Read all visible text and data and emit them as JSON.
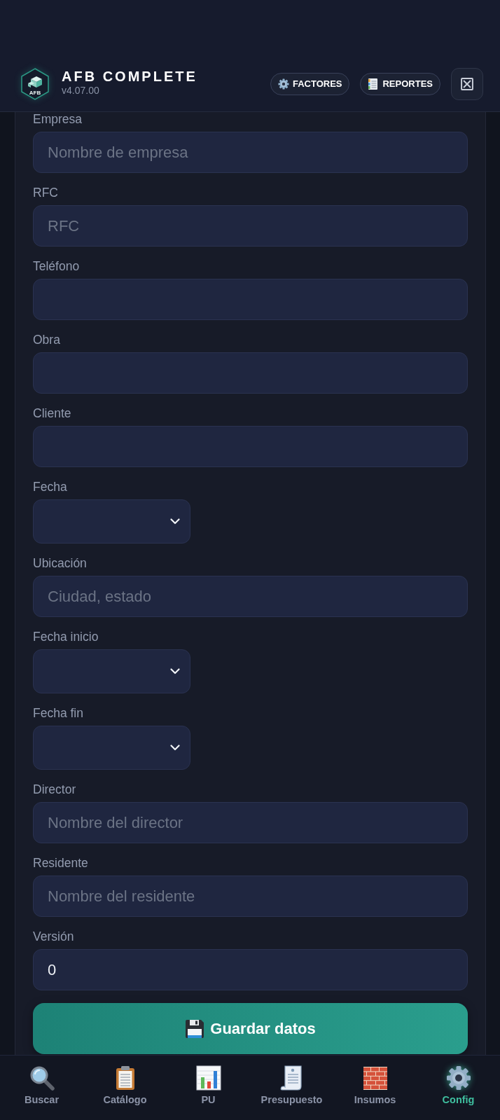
{
  "app": {
    "logo_text": "AFB",
    "title": "AFB COMPLETE",
    "version": "v4.07.00"
  },
  "header_buttons": [
    {
      "label": "FACTORES"
    },
    {
      "label": "REPORTES"
    }
  ],
  "form": {
    "fields": [
      {
        "label": "Empresa",
        "kind": "text",
        "placeholder": "Nombre de empresa"
      },
      {
        "label": "RFC",
        "kind": "text",
        "placeholder": "RFC"
      },
      {
        "label": "Teléfono",
        "kind": "text"
      },
      {
        "label": "Obra",
        "kind": "text"
      },
      {
        "label": "Cliente",
        "kind": "text"
      },
      {
        "label": "Fecha",
        "kind": "date"
      },
      {
        "label": "Ubicación",
        "kind": "text",
        "placeholder": "Ciudad, estado"
      },
      {
        "label": "Fecha inicio",
        "kind": "date"
      },
      {
        "label": "Fecha fin",
        "kind": "date"
      },
      {
        "label": "Director",
        "kind": "text",
        "placeholder": "Nombre del director"
      },
      {
        "label": "Residente",
        "kind": "text",
        "placeholder": "Nombre del residente"
      },
      {
        "label": "Versión",
        "kind": "text",
        "value": "0"
      }
    ],
    "save_button": "Guardar datos"
  },
  "bottom_nav": [
    {
      "label": "Buscar",
      "selected": false
    },
    {
      "label": "Catálogo",
      "selected": false
    },
    {
      "label": "PU",
      "selected": false
    },
    {
      "label": "Presupuesto",
      "selected": false
    },
    {
      "label": "Insumos",
      "selected": false
    },
    {
      "label": "Config",
      "selected": true
    }
  ]
}
